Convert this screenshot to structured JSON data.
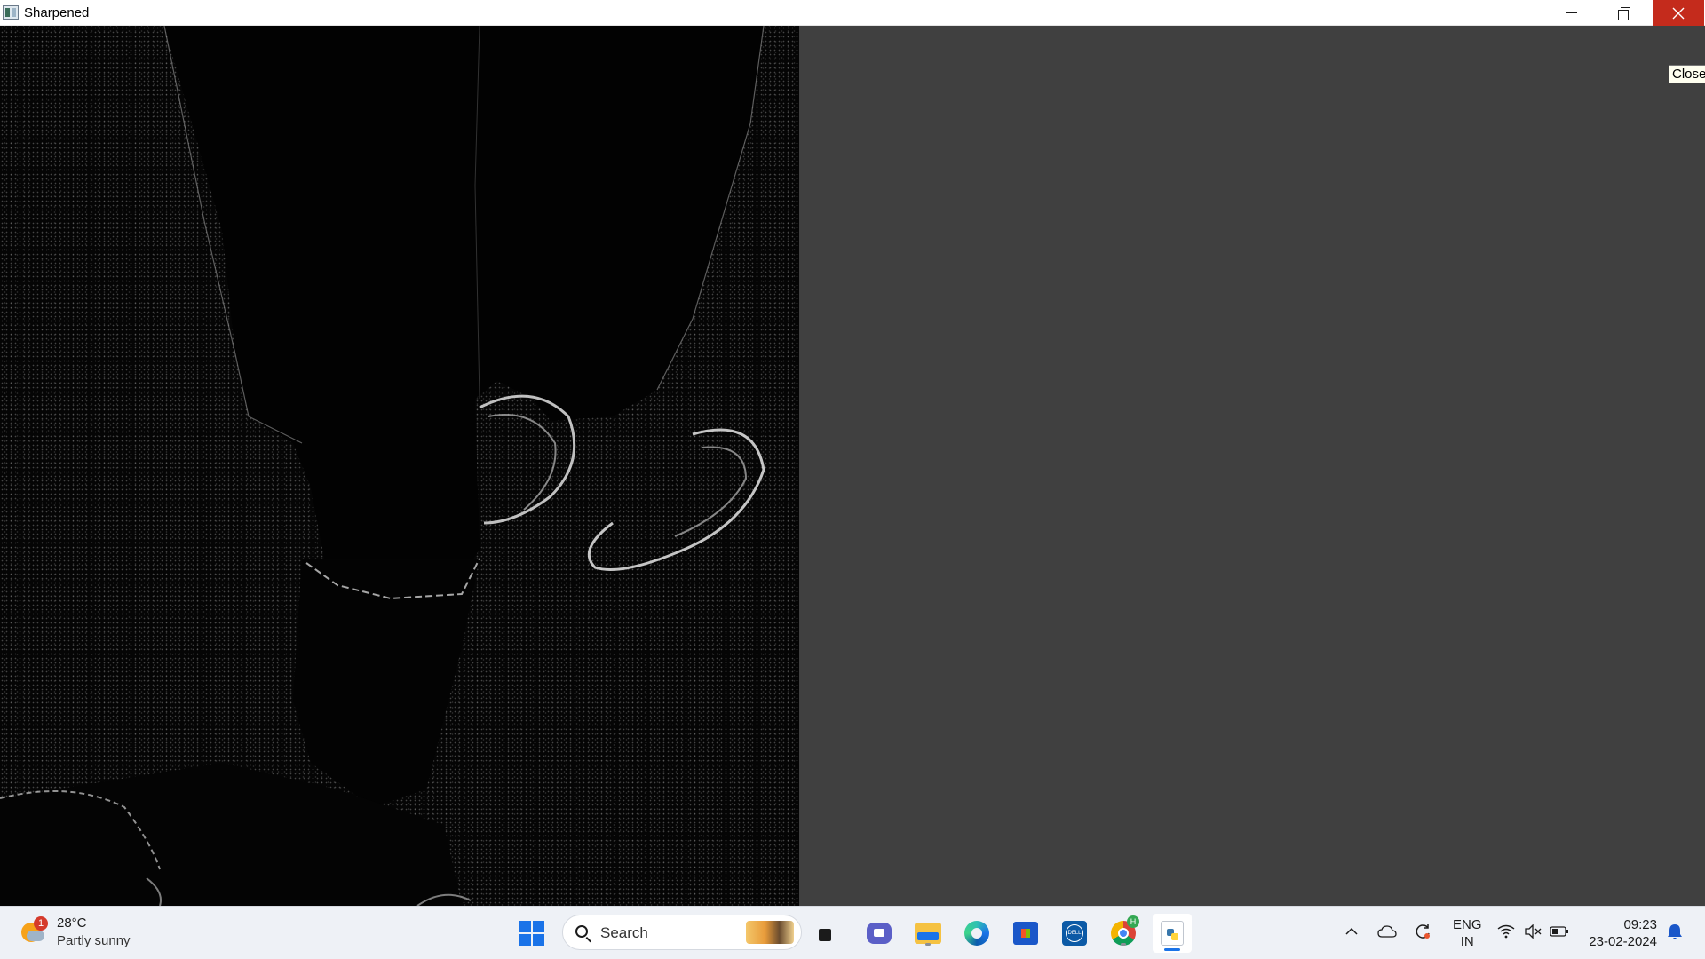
{
  "window": {
    "title": "Sharpened",
    "tooltip": "Close"
  },
  "taskbar": {
    "weather": {
      "badge": "1",
      "temperature": "28°C",
      "condition": "Partly sunny"
    },
    "search": {
      "placeholder": "Search"
    },
    "pinned_apps": [
      "start",
      "search",
      "task-view",
      "chat",
      "file-explorer",
      "edge",
      "microsoft-store",
      "dell",
      "chrome",
      "python"
    ],
    "chrome_badge": "H",
    "tray": {
      "language_line1": "ENG",
      "language_line2": "IN",
      "time": "09:23",
      "date": "23-02-2024"
    }
  },
  "colors": {
    "close_button": "#c42b1c",
    "background": "#404040",
    "image_background": "#050505",
    "accent": "#1a73e8"
  }
}
